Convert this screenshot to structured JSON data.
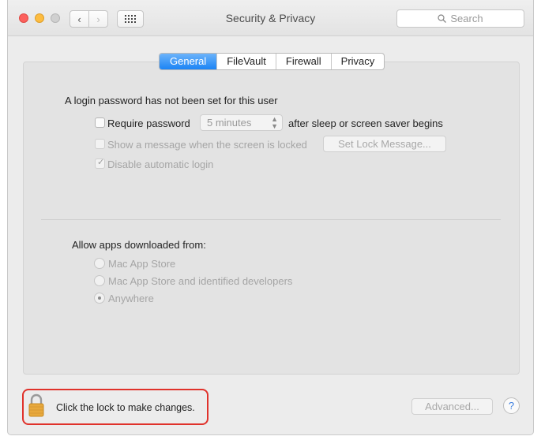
{
  "window": {
    "title": "Security & Privacy",
    "search_placeholder": "Search"
  },
  "nav": {
    "back_glyph": "‹",
    "forward_glyph": "›"
  },
  "tabs": [
    {
      "label": "General",
      "active": true
    },
    {
      "label": "FileVault",
      "active": false
    },
    {
      "label": "Firewall",
      "active": false
    },
    {
      "label": "Privacy",
      "active": false
    }
  ],
  "general": {
    "login_heading": "A login password has not been set for this user",
    "require_password": {
      "label": "Require password",
      "checked": false
    },
    "password_delay": "5 minutes",
    "after_sleep_text": "after sleep or screen saver begins",
    "show_message": {
      "label": "Show a message when the screen is locked",
      "checked": false,
      "enabled": false
    },
    "set_lock_message_button": "Set Lock Message...",
    "disable_auto_login": {
      "label": "Disable automatic login",
      "checked": true,
      "enabled": false
    },
    "allow_apps_heading": "Allow apps downloaded from:",
    "allow_apps_options": [
      {
        "label": "Mac App Store",
        "selected": false
      },
      {
        "label": "Mac App Store and identified developers",
        "selected": false
      },
      {
        "label": "Anywhere",
        "selected": true
      }
    ]
  },
  "footer": {
    "lock_text": "Click the lock to make changes.",
    "advanced_button": "Advanced...",
    "help_label": "?"
  },
  "colors": {
    "accent": "#1b84f5",
    "highlight_border": "#e0322b",
    "lock": "#e8a93c"
  },
  "icons": {
    "close": "close-icon",
    "minimize": "minimize-icon",
    "zoom": "zoom-icon",
    "grid": "grid-icon",
    "search": "search-icon",
    "lock": "lock-icon",
    "checkmark": "checkmark-icon"
  }
}
